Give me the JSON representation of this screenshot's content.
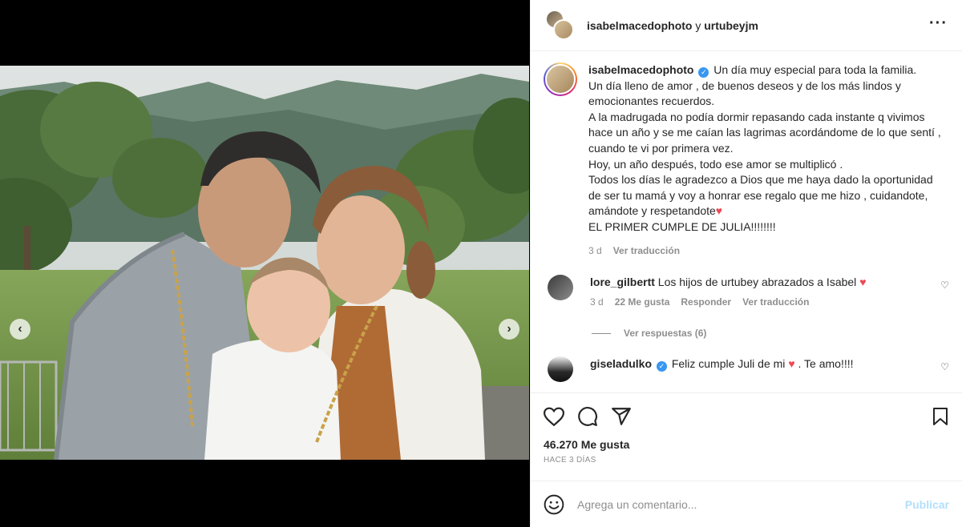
{
  "post": {
    "authors_primary": "isabelmacedophoto",
    "authors_joiner": "y",
    "authors_secondary": "urtubeyjm",
    "more_icon": "more-horizontal-icon"
  },
  "caption": {
    "username": "isabelmacedophoto",
    "lines": [
      "Un día muy especial para toda la familia.",
      "Un día lleno de amor , de buenos deseos y de los más lindos y emocionantes recuerdos.",
      "A la madrugada no podía dormir repasando cada instante q vivimos hace un año y se me caían las lagrimas acordándome de lo que sentí , cuando te vi por primera vez.",
      "Hoy, un año después, todo ese amor se multiplicó .",
      "Todos los días le agradezco a Dios que me haya dado la oportunidad de ser tu mamá y voy a honrar ese regalo que me hizo , cuidandote, amándote y respetandote",
      "EL PRIMER CUMPLE DE JULIA!!!!!!!!"
    ],
    "time": "3 d",
    "translate": "Ver traducción"
  },
  "comments": [
    {
      "username": "lore_gilbertt",
      "text": "Los hijos de urtubey abrazados a Isabel",
      "time": "3 d",
      "likes": "22 Me gusta",
      "reply": "Responder",
      "translate": "Ver traducción",
      "view_replies": "Ver respuestas (6)"
    },
    {
      "username": "giseladulko",
      "text_before": "Feliz cumple Juli de mi",
      "text_after": ". Te amo!!!!"
    }
  ],
  "stats": {
    "likes": "46.270 Me gusta",
    "ago": "HACE 3 DÍAS"
  },
  "composer": {
    "placeholder": "Agrega un comentario...",
    "publish": "Publicar"
  },
  "colors": {
    "accent_blue": "#0095f6",
    "heart_red": "#ed4956",
    "muted": "#8e8e8e"
  }
}
